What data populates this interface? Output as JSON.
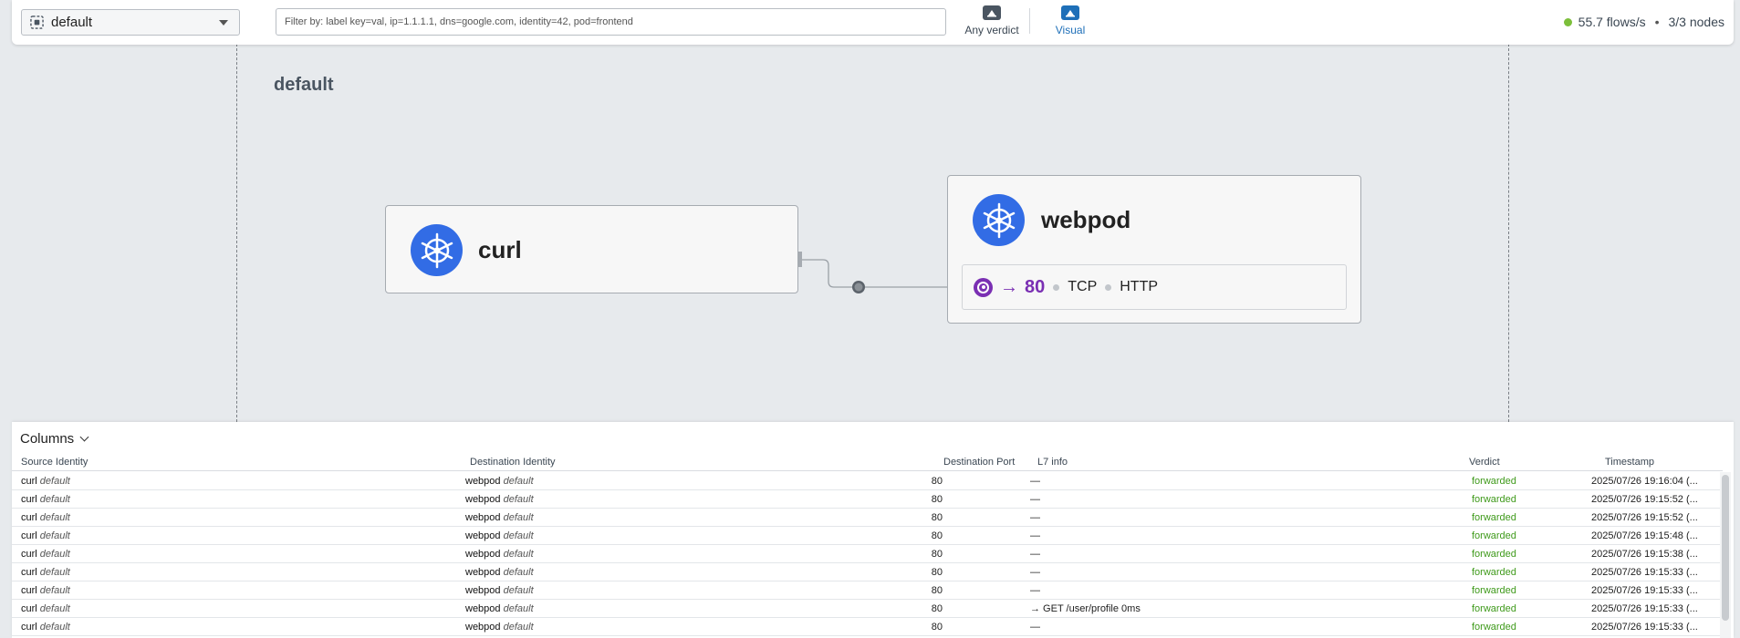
{
  "topbar": {
    "namespace": "default",
    "filter_placeholder": "Filter by: label key=val, ip=1.1.1.1, dns=google.com, identity=42, pod=frontend",
    "any_verdict_label": "Any verdict",
    "visual_label": "Visual",
    "flows_rate": "55.7 flows/s",
    "separator": "•",
    "nodes": "3/3 nodes",
    "status_color": "#7cbf3a"
  },
  "canvas": {
    "namespace_title": "default",
    "cards": [
      {
        "name": "curl",
        "icon": "kubernetes-icon"
      },
      {
        "name": "webpod",
        "icon": "kubernetes-icon",
        "port": {
          "arrow": "→",
          "number": "80",
          "protocols": [
            "TCP",
            "HTTP"
          ]
        }
      }
    ]
  },
  "table": {
    "columns_label": "Columns",
    "headers": {
      "source": "Source Identity",
      "destination": "Destination Identity",
      "port": "Destination Port",
      "l7": "L7 info",
      "verdict": "Verdict",
      "timestamp": "Timestamp"
    },
    "rows": [
      {
        "src": "curl",
        "src_ns": "default",
        "dst": "webpod",
        "dst_ns": "default",
        "port": "80",
        "l7": "—",
        "verdict": "forwarded",
        "ts": "2025/07/26 19:16:04 (..."
      },
      {
        "src": "curl",
        "src_ns": "default",
        "dst": "webpod",
        "dst_ns": "default",
        "port": "80",
        "l7": "—",
        "verdict": "forwarded",
        "ts": "2025/07/26 19:15:52 (..."
      },
      {
        "src": "curl",
        "src_ns": "default",
        "dst": "webpod",
        "dst_ns": "default",
        "port": "80",
        "l7": "—",
        "verdict": "forwarded",
        "ts": "2025/07/26 19:15:52 (..."
      },
      {
        "src": "curl",
        "src_ns": "default",
        "dst": "webpod",
        "dst_ns": "default",
        "port": "80",
        "l7": "—",
        "verdict": "forwarded",
        "ts": "2025/07/26 19:15:48 (..."
      },
      {
        "src": "curl",
        "src_ns": "default",
        "dst": "webpod",
        "dst_ns": "default",
        "port": "80",
        "l7": "—",
        "verdict": "forwarded",
        "ts": "2025/07/26 19:15:38 (..."
      },
      {
        "src": "curl",
        "src_ns": "default",
        "dst": "webpod",
        "dst_ns": "default",
        "port": "80",
        "l7": "—",
        "verdict": "forwarded",
        "ts": "2025/07/26 19:15:33 (..."
      },
      {
        "src": "curl",
        "src_ns": "default",
        "dst": "webpod",
        "dst_ns": "default",
        "port": "80",
        "l7": "—",
        "verdict": "forwarded",
        "ts": "2025/07/26 19:15:33 (..."
      },
      {
        "src": "curl",
        "src_ns": "default",
        "dst": "webpod",
        "dst_ns": "default",
        "port": "80",
        "l7": "→  GET  /user/profile  0ms",
        "verdict": "forwarded",
        "ts": "2025/07/26 19:15:33 (..."
      },
      {
        "src": "curl",
        "src_ns": "default",
        "dst": "webpod",
        "dst_ns": "default",
        "port": "80",
        "l7": "—",
        "verdict": "forwarded",
        "ts": "2025/07/26 19:15:33 (..."
      }
    ]
  }
}
